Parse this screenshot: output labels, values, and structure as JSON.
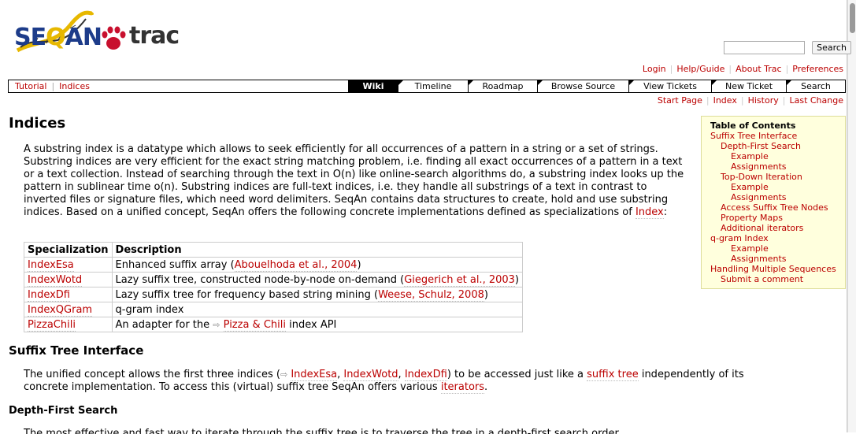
{
  "header": {
    "logo_text_seq": "SE",
    "logo_text_q": "Q",
    "logo_text_an": "AN",
    "logo_text_trac": "trac",
    "search_placeholder": "",
    "search_button": "Search"
  },
  "metanav": [
    "Login",
    "Help/Guide",
    "About Trac",
    "Preferences"
  ],
  "mainnav": {
    "left": [
      "Tutorial",
      "Indices"
    ],
    "tabs": [
      {
        "label": "Wiki",
        "active": true
      },
      {
        "label": "Timeline",
        "active": false
      },
      {
        "label": "Roadmap",
        "active": false
      },
      {
        "label": "Browse Source",
        "active": false
      },
      {
        "label": "View Tickets",
        "active": false
      },
      {
        "label": "New Ticket",
        "active": false
      },
      {
        "label": "Search",
        "active": false
      }
    ]
  },
  "ctxtnav": [
    "Start Page",
    "Index",
    "History",
    "Last Change"
  ],
  "page": {
    "title": "Indices",
    "intro_before_link": "A substring index is a datatype which allows to seek efficiently for all occurrences of a pattern in a string or a set of strings. Substring indices are very efficient for the exact string matching problem, i.e. finding all exact occurrences of a pattern in a text or a text collection. Instead of searching through the text in O(n) like online-search algorithms do, a substring index looks up the pattern in sublinear time o(n). Substring indices are full-text indices, i.e. they handle all substrings of a text in contrast to inverted files or signature files, which need word delimiters. SeqAn contains data structures to create, hold and use substring indices. Based on a unified concept, SeqAn offers the following concrete implementations defined as specializations of ",
    "intro_link": "Index",
    "intro_after_link": ":",
    "table": {
      "headers": [
        "Specialization",
        "Description"
      ],
      "rows": [
        {
          "spec": "IndexEsa",
          "desc_before": "Enhanced suffix array (",
          "desc_link": "Abouelhoda et al., 2004",
          "desc_after": ")"
        },
        {
          "spec": "IndexWotd",
          "desc_before": "Lazy suffix tree, constructed node-by-node on-demand (",
          "desc_link": "Giegerich et al., 2003",
          "desc_after": ")"
        },
        {
          "spec": "IndexDfi",
          "desc_before": "Lazy suffix tree for frequency based string mining (",
          "desc_link": "Weese, Schulz, 2008",
          "desc_after": ")"
        },
        {
          "spec": "IndexQGram",
          "desc_before": "q-gram index",
          "desc_link": "",
          "desc_after": ""
        },
        {
          "spec": "PizzaChili",
          "desc_before": "An adapter for the ",
          "desc_link": "Pizza & Chili",
          "desc_after": " index API"
        }
      ]
    },
    "section1_title": "Suffix Tree Interface",
    "section1_text": {
      "t1": "The unified concept allows the first three indices (",
      "l1": "IndexEsa",
      "t2": ", ",
      "l2": "IndexWotd",
      "t3": ", ",
      "l3": "IndexDfi",
      "t4": ") to be accessed just like a ",
      "l4": "suffix tree",
      "t5": " independently of its concrete implementation. To access this (virtual) suffix tree SeqAn offers various ",
      "l5": "iterators",
      "t6": "."
    },
    "section2_title": "Depth-First Search",
    "section2_text": "The most effective and fast way to iterate through the suffix tree is to traverse the tree in a depth-first search order."
  },
  "toc": {
    "title": "Table of Contents",
    "items": [
      {
        "label": "Suffix Tree Interface",
        "level": 1
      },
      {
        "label": "Depth-First Search",
        "level": 2
      },
      {
        "label": "Example",
        "level": 3
      },
      {
        "label": "Assignments",
        "level": 3
      },
      {
        "label": "Top-Down Iteration",
        "level": 2
      },
      {
        "label": "Example",
        "level": 3
      },
      {
        "label": "Assignments",
        "level": 3
      },
      {
        "label": "Access Suffix Tree Nodes",
        "level": 2
      },
      {
        "label": "Property Maps",
        "level": 2
      },
      {
        "label": "Additional iterators",
        "level": 2
      },
      {
        "label": "q-gram Index",
        "level": 1
      },
      {
        "label": "Example",
        "level": 3
      },
      {
        "label": "Assignments",
        "level": 3
      },
      {
        "label": "Handling Multiple Sequences",
        "level": 1
      },
      {
        "label": "Submit a comment",
        "level": 2
      }
    ]
  },
  "colors": {
    "link": "#bb0000",
    "toc_bg": "#ffffdd",
    "logo_blue": "#1d3c8a",
    "logo_yellow": "#e7b800"
  },
  "icons": [
    "paw-icon",
    "external-link-icon",
    "dna-helix-icon"
  ]
}
